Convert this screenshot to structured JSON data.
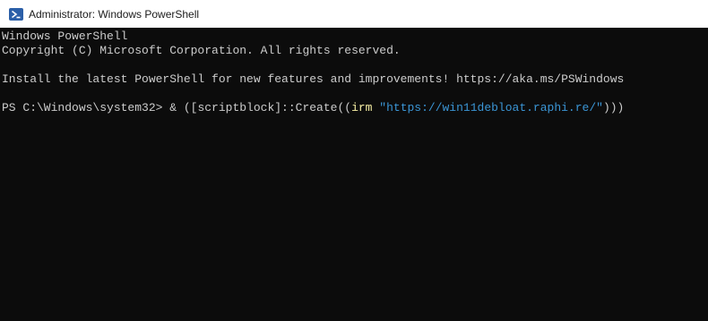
{
  "window": {
    "title": "Administrator: Windows PowerShell",
    "icon": "powershell-icon"
  },
  "console": {
    "lines": [
      "Windows PowerShell",
      "Copyright (C) Microsoft Corporation. All rights reserved.",
      "",
      "Install the latest PowerShell for new features and improvements! https://aka.ms/PSWindows",
      ""
    ],
    "prompt": {
      "text": "PS C:\\Windows\\system32> ",
      "cmd_part1": "& ([scriptblock]::Create((",
      "cmd_irm": "irm",
      "cmd_space": " ",
      "cmd_string": "\"https://win11debloat.raphi.re/\"",
      "cmd_end": ")))"
    }
  },
  "colors": {
    "background": "#0c0c0c",
    "foreground": "#cccccc",
    "command": "#f9f1a5",
    "string": "#3b96d6",
    "titlebar": "#ffffff"
  }
}
